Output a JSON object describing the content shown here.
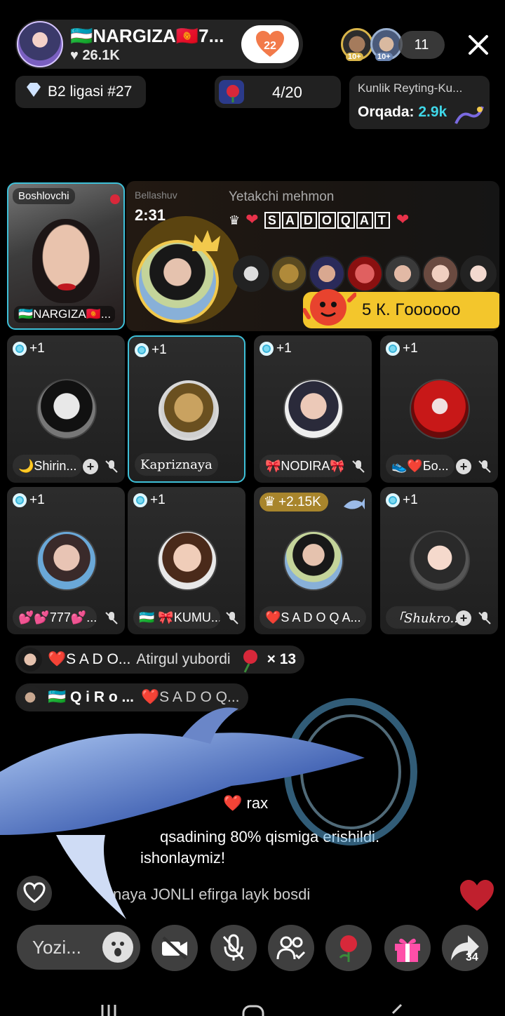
{
  "header": {
    "host_name": "🇺🇿NARGIZA🇰🇬7...",
    "host_likes": "26.1K",
    "follow_badge_count": "22",
    "viewer_badges": [
      "10+",
      "10+"
    ],
    "viewer_count": "11"
  },
  "stats": {
    "league": "B2 ligasi #27",
    "gift_goal": "4/20",
    "rating_title": "Kunlik Reyting-Ku...",
    "rating_behind_label": "Orqada:",
    "rating_behind_value": "2.9k"
  },
  "host_seat": {
    "role": "Boshlovchi",
    "name": "🇺🇿NARGIZA🇰🇬..."
  },
  "battle": {
    "label": "Bellashuv",
    "timer": "2:31",
    "leader_title": "Yetakchi mehmon",
    "leader_letters": [
      "S",
      "A",
      "D",
      "O",
      "Q",
      "A",
      "T"
    ],
    "promo_text": "5 К. Гoooooo"
  },
  "seats": [
    {
      "badge": "+1",
      "name": "🌙Shirin..."
    },
    {
      "badge": "+1",
      "name": "Kapriznaya"
    },
    {
      "badge": "+1",
      "name": "🎀NODIRA🎀"
    },
    {
      "badge": "+1",
      "name": "👟❤️Бо..."
    },
    {
      "badge": "+1",
      "name": "💕💕777💕..."
    },
    {
      "badge": "+1",
      "name": "🇺🇿 🎀KUMU..."
    },
    {
      "badge": "+2.15K",
      "name": "❤️S A D O Q A..."
    },
    {
      "badge": "+1",
      "name": "「Shukro..."
    }
  ],
  "chat": {
    "gift_msg_user": "❤️S A D O...",
    "gift_msg_text": "Atirgul  yubordi",
    "gift_msg_count": "× 13",
    "join_msg_user": "🇺🇿 Q i R o ...",
    "join_msg_target": "❤️S A D O Q...",
    "line3": "❤️ rax",
    "line4": "qsadining 80% qismiga erishildi.",
    "line5": "ishonlaymiz!",
    "like_msg": "znaya JONLI efirga layk bosdi"
  },
  "bottom": {
    "comment_placeholder": "Yozi...",
    "share_count": "34"
  },
  "colors": {
    "accent_cyan": "#3ec0d8",
    "gold": "#f2c94c",
    "promo_yellow": "#f3c62c",
    "heart_red": "#e8324a"
  }
}
